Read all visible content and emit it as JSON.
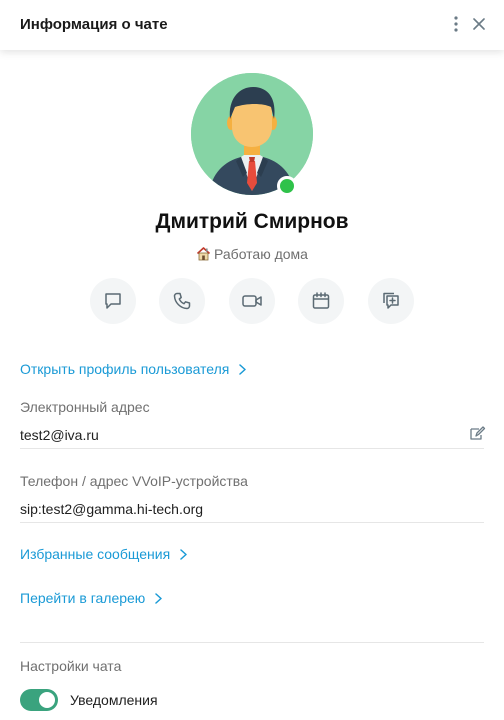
{
  "header": {
    "title": "Информация о чате",
    "more_icon": "more-vertical-icon",
    "close_icon": "close-icon"
  },
  "profile": {
    "name": "Дмитрий Смирнов",
    "status_emoji": "house-icon",
    "status_text": "Работаю дома",
    "online": true,
    "online_color": "#2fc24a",
    "avatar_bg": "#86d4a5"
  },
  "actions": [
    {
      "icon": "chat-icon"
    },
    {
      "icon": "phone-icon"
    },
    {
      "icon": "video-camera-icon"
    },
    {
      "icon": "calendar-icon"
    },
    {
      "icon": "add-message-icon"
    }
  ],
  "links": {
    "open_profile": "Открыть профиль пользователя",
    "favorites": "Избранные сообщения",
    "gallery": "Перейти в галерею"
  },
  "fields": {
    "email_label": "Электронный адрес",
    "email_value": "test2@iva.ru",
    "phone_label": "Телефон / адрес VVoIP-устройства",
    "phone_value": "sip:test2@gamma.hi-tech.org"
  },
  "settings": {
    "section_label": "Настройки чата",
    "notifications_label": "Уведомления",
    "notifications_on": true
  },
  "colors": {
    "accent": "#1a9ad6",
    "toggle_on": "#3aa37e",
    "icon_gray": "#5b6a73"
  }
}
